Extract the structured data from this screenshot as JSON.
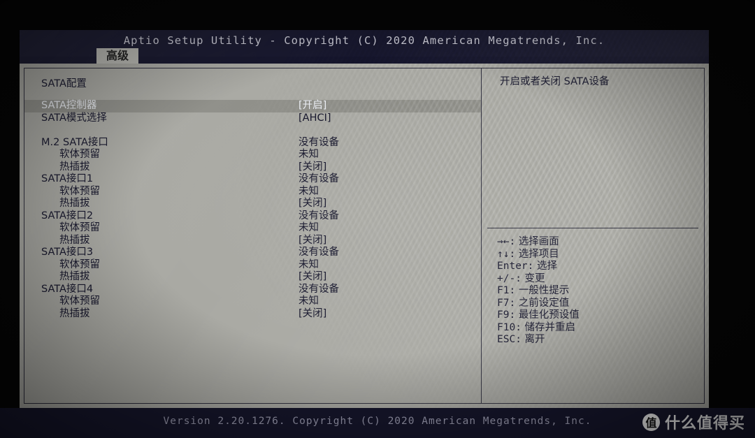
{
  "screen": {
    "title": "Aptio Setup Utility - Copyright (C) 2020 American Megatrends, Inc.",
    "footer": "Version 2.20.1276. Copyright (C) 2020 American Megatrends, Inc."
  },
  "tab": {
    "label": "高级"
  },
  "section": {
    "heading": "SATA配置"
  },
  "settings": [
    {
      "label": "SATA控制器",
      "value": "[开启]",
      "indent": false,
      "selected": true
    },
    {
      "label": "SATA模式选择",
      "value": "[AHCI]",
      "indent": false,
      "selected": false
    },
    {
      "label": "M.2 SATA接口",
      "value": "没有设备",
      "indent": false,
      "selected": false
    },
    {
      "label": "软体预留",
      "value": "未知",
      "indent": true,
      "selected": false
    },
    {
      "label": "热插拔",
      "value": "[关闭]",
      "indent": true,
      "selected": false
    },
    {
      "label": "SATA接口1",
      "value": "没有设备",
      "indent": false,
      "selected": false
    },
    {
      "label": "软体预留",
      "value": "未知",
      "indent": true,
      "selected": false
    },
    {
      "label": "热插拔",
      "value": "[关闭]",
      "indent": true,
      "selected": false
    },
    {
      "label": "SATA接口2",
      "value": "没有设备",
      "indent": false,
      "selected": false
    },
    {
      "label": "软体预留",
      "value": "未知",
      "indent": true,
      "selected": false
    },
    {
      "label": "热插拔",
      "value": "[关闭]",
      "indent": true,
      "selected": false
    },
    {
      "label": "SATA接口3",
      "value": "没有设备",
      "indent": false,
      "selected": false
    },
    {
      "label": "软体预留",
      "value": "未知",
      "indent": true,
      "selected": false
    },
    {
      "label": "热插拔",
      "value": "[关闭]",
      "indent": true,
      "selected": false
    },
    {
      "label": "SATA接口4",
      "value": "没有设备",
      "indent": false,
      "selected": false
    },
    {
      "label": "软体预留",
      "value": "未知",
      "indent": true,
      "selected": false
    },
    {
      "label": "热插拔",
      "value": "[关闭]",
      "indent": true,
      "selected": false
    }
  ],
  "help": {
    "text": "开启或者关闭 SATA设备"
  },
  "legend": [
    {
      "key": "→←:",
      "desc": "选择画面"
    },
    {
      "key": "↑↓:",
      "desc": "选择项目"
    },
    {
      "key": "Enter:",
      "desc": "选择"
    },
    {
      "key": "+/-:",
      "desc": "变更"
    },
    {
      "key": "F1:",
      "desc": "一般性提示"
    },
    {
      "key": "F7:",
      "desc": "之前设定值"
    },
    {
      "key": "F9:",
      "desc": "最佳化预设值"
    },
    {
      "key": "F10:",
      "desc": "储存并重启"
    },
    {
      "key": "ESC:",
      "desc": "离开"
    }
  ],
  "watermark": {
    "badge": "值",
    "text": "什么值得买"
  },
  "colors": {
    "title_bar": "#17172e",
    "panel_bg": "#a9a9a3",
    "text": "#14142a",
    "selected_bg": "#8f8f89",
    "selected_text": "#eceff5",
    "tab_bg": "#b9b9b3"
  }
}
